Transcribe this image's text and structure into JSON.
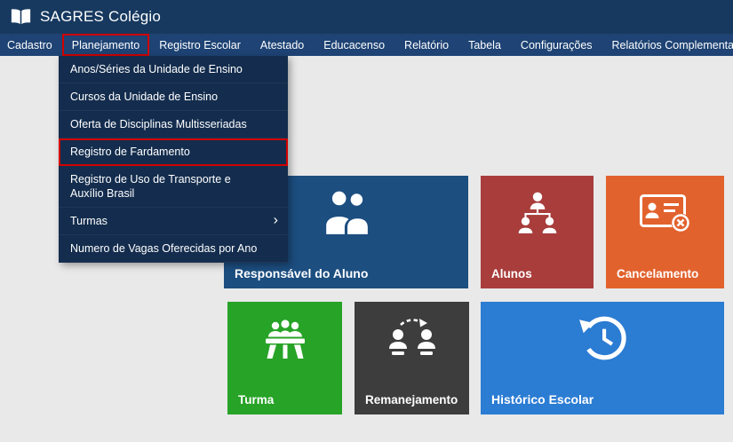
{
  "app": {
    "window_title": "SAGRES Colégio"
  },
  "menubar": {
    "items": [
      {
        "label": "Cadastro",
        "highlighted": false
      },
      {
        "label": "Planejamento",
        "highlighted": true
      },
      {
        "label": "Registro Escolar",
        "highlighted": false
      },
      {
        "label": "Atestado",
        "highlighted": false
      },
      {
        "label": "Educacenso",
        "highlighted": false
      },
      {
        "label": "Relatório",
        "highlighted": false
      },
      {
        "label": "Tabela",
        "highlighted": false
      },
      {
        "label": "Configurações",
        "highlighted": false
      },
      {
        "label": "Relatórios Complementares",
        "highlighted": false
      }
    ]
  },
  "dropdown": {
    "items": [
      {
        "label": "Anos/Séries da Unidade de Ensino",
        "highlighted": false,
        "has_submenu": false
      },
      {
        "label": "Cursos da Unidade de Ensino",
        "highlighted": false,
        "has_submenu": false
      },
      {
        "label": "Oferta de Disciplinas Multisseriadas",
        "highlighted": false,
        "has_submenu": false
      },
      {
        "label": "Registro de Fardamento",
        "highlighted": true,
        "has_submenu": false
      },
      {
        "label": "Registro de Uso de Transporte e Auxílio Brasil",
        "highlighted": false,
        "has_submenu": false
      },
      {
        "label": "Turmas",
        "highlighted": false,
        "has_submenu": true
      },
      {
        "label": "Numero de Vagas Oferecidas por Ano",
        "highlighted": false,
        "has_submenu": false
      }
    ],
    "submenu_arrow": "›"
  },
  "tiles": [
    {
      "label": "Responsável do Aluno",
      "color": "#1c4e80",
      "icon": "guardians-icon"
    },
    {
      "label": "Alunos",
      "color": "#a83d3b",
      "icon": "students-icon"
    },
    {
      "label": "Cancelamento",
      "color": "#e2622e",
      "icon": "cancel-id-card-icon"
    },
    {
      "label": "Turma",
      "color": "#27a327",
      "icon": "class-group-icon"
    },
    {
      "label": "Remanejamento",
      "color": "#3d3d3d",
      "icon": "transfer-people-icon"
    },
    {
      "label": "Histórico Escolar",
      "color": "#2b7cd3",
      "icon": "history-clock-icon"
    }
  ],
  "colors": {
    "topbar": "#17395f",
    "menubar": "#1e4374",
    "dropdown": "#142d4e",
    "highlight_red": "#d10000",
    "main_background": "#e9e9e9"
  }
}
